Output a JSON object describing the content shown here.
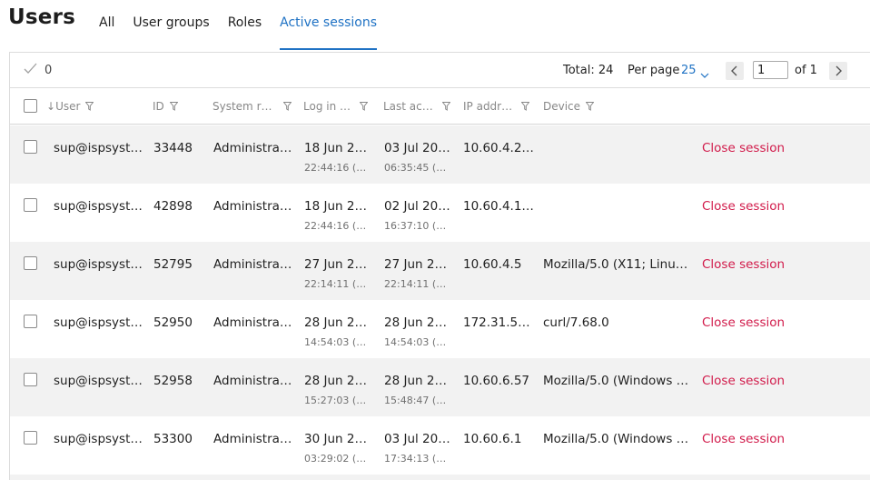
{
  "page": {
    "title": "Users"
  },
  "tabs": [
    {
      "label": "All",
      "active": false
    },
    {
      "label": "User groups",
      "active": false
    },
    {
      "label": "Roles",
      "active": false
    },
    {
      "label": "Active sessions",
      "active": true
    }
  ],
  "toolbar": {
    "selected_count": "0",
    "total_label": "Total: 24",
    "per_page_label": "Per page",
    "per_page_value": "25",
    "page_input_value": "1",
    "of_label": "of 1"
  },
  "columns": {
    "user": "User",
    "id": "ID",
    "system_role": "System r…",
    "log_in": "Log in …",
    "last_activity": "Last ac…",
    "ip_address": "IP addr…",
    "device": "Device"
  },
  "action_label": "Close session",
  "rows": [
    {
      "user": "sup@ispsyst…",
      "id": "33448",
      "role": "Administra…",
      "login_date": "18 Jun 2…",
      "login_time": "22:44:16 (…",
      "last_date": "03 Jul 20…",
      "last_time": "06:35:45 (…",
      "ip": "10.60.4.2…",
      "device": ""
    },
    {
      "user": "sup@ispsyst…",
      "id": "42898",
      "role": "Administra…",
      "login_date": "18 Jun 2…",
      "login_time": "22:44:16 (…",
      "last_date": "02 Jul 20…",
      "last_time": "16:37:10 (…",
      "ip": "10.60.4.1…",
      "device": ""
    },
    {
      "user": "sup@ispsyst…",
      "id": "52795",
      "role": "Administra…",
      "login_date": "27 Jun 2…",
      "login_time": "22:14:11 (…",
      "last_date": "27 Jun 2…",
      "last_time": "22:14:11 (…",
      "ip": "10.60.4.5",
      "device": "Mozilla/5.0 (X11; Linux…"
    },
    {
      "user": "sup@ispsyst…",
      "id": "52950",
      "role": "Administra…",
      "login_date": "28 Jun 2…",
      "login_time": "14:54:03 (…",
      "last_date": "28 Jun 2…",
      "last_time": "14:54:03 (…",
      "ip": "172.31.5…",
      "device": "curl/7.68.0"
    },
    {
      "user": "sup@ispsyst…",
      "id": "52958",
      "role": "Administra…",
      "login_date": "28 Jun 2…",
      "login_time": "15:27:03 (…",
      "last_date": "28 Jun 2…",
      "last_time": "15:48:47 (…",
      "ip": "10.60.6.57",
      "device": "Mozilla/5.0 (Windows …"
    },
    {
      "user": "sup@ispsyst…",
      "id": "53300",
      "role": "Administra…",
      "login_date": "30 Jun 2…",
      "login_time": "03:29:02 (…",
      "last_date": "03 Jul 20…",
      "last_time": "17:34:13 (…",
      "ip": "10.60.6.1",
      "device": "Mozilla/5.0 (Windows …"
    }
  ]
}
